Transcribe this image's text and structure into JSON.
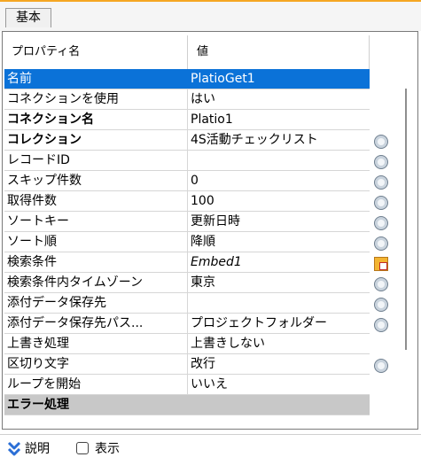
{
  "tab": {
    "label": "基本"
  },
  "grid": {
    "header": {
      "name": "プロパティ名",
      "value": "値"
    },
    "rows": [
      {
        "name": "名前",
        "value": "PlatioGet1"
      },
      {
        "name": "コネクションを使用",
        "value": "はい"
      },
      {
        "name": "コネクション名",
        "value": "Platio1"
      },
      {
        "name": "コレクション",
        "value": "4S活動チェックリスト"
      },
      {
        "name": "レコードID",
        "value": ""
      },
      {
        "name": "スキップ件数",
        "value": "0"
      },
      {
        "name": "取得件数",
        "value": "100"
      },
      {
        "name": "ソートキー",
        "value": "更新日時"
      },
      {
        "name": "ソート順",
        "value": "降順"
      },
      {
        "name": "検索条件",
        "value": "Embed1"
      },
      {
        "name": "検索条件内タイムゾーン",
        "value": "東京"
      },
      {
        "name": "添付データ保存先",
        "value": ""
      },
      {
        "name": "添付データ保存先パス...",
        "value": "プロジェクトフォルダー"
      },
      {
        "name": "上書き処理",
        "value": "上書きしない"
      },
      {
        "name": "区切り文字",
        "value": "改行"
      },
      {
        "name": "ループを開始",
        "value": "いいえ"
      },
      {
        "name": "エラー処理",
        "value": ""
      }
    ]
  },
  "footer": {
    "description_label": "説明",
    "show_label": "表示",
    "show_checked": false
  },
  "colors": {
    "selection": "#0b72d8",
    "section": "#c8c8c8",
    "accent_strip": "#f5a623"
  }
}
